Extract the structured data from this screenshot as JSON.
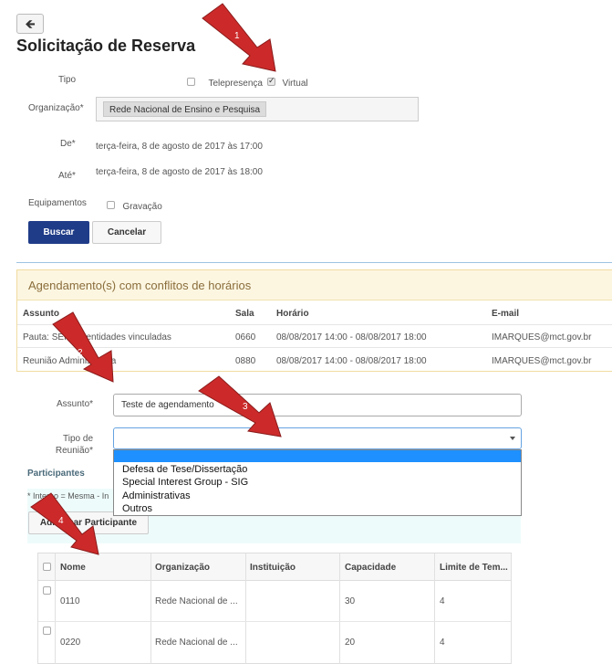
{
  "page": {
    "title": "Solicitação de Reserva"
  },
  "form": {
    "tipo_label": "Tipo",
    "tipo_options": [
      {
        "label": "Telepresença",
        "checked": false
      },
      {
        "label": "Virtual",
        "checked": true
      }
    ],
    "organizacao_label": "Organização*",
    "organizacao_value": "Rede Nacional de Ensino e Pesquisa",
    "de_label": "De*",
    "de_value": "terça-feira, 8 de agosto de 2017 às 17:00",
    "ate_label": "Até*",
    "ate_value": "terça-feira, 8 de agosto de 2017 às 18:00",
    "equipamentos_label": "Equipamentos",
    "gravacao_label": "Gravação",
    "buscar_label": "Buscar",
    "cancelar_label": "Cancelar"
  },
  "conflicts": {
    "title": "Agendamento(s) com conflitos de horários",
    "columns": [
      "Assunto",
      "Sala",
      "Horário",
      "E-mail"
    ],
    "rows": [
      {
        "assunto": "Pauta: SEI nas entidades vinculadas",
        "sala": "0660",
        "horario": "08/08/2017 14:00 - 08/08/2017 18:00",
        "email": "IMARQUES@mct.gov.br"
      },
      {
        "assunto": "Reunião Administrativa",
        "sala": "0880",
        "horario": "08/08/2017 14:00 - 08/08/2017 18:00",
        "email": "IMARQUES@mct.gov.br"
      }
    ]
  },
  "meeting": {
    "assunto_label": "Assunto*",
    "assunto_value": "Teste de agendamento",
    "tipo_label_line1": "Tipo de",
    "tipo_label_line2": "Reunião*",
    "tipo_options": [
      "Defesa de Tese/Dissertação",
      "Special Interest Group - SIG",
      "Administrativas",
      "Outros"
    ]
  },
  "participants": {
    "title": "Participantes",
    "note": "* Interno = Mesma - In",
    "add_label": "Adicionar Participante",
    "columns": [
      "Nome",
      "Organização",
      "Instituição",
      "Capacidade",
      "Limite de Tem..."
    ],
    "rows": [
      {
        "nome": "0110",
        "organizacao": "Rede Nacional de ...",
        "instituicao": "",
        "capacidade": "30",
        "limite": "4"
      },
      {
        "nome": "0220",
        "organizacao": "Rede Nacional de ...",
        "instituicao": "",
        "capacidade": "20",
        "limite": "4"
      }
    ]
  },
  "annotations": [
    "1",
    "2",
    "3",
    "4"
  ],
  "colors": {
    "primary_button": "#1f3c88",
    "annotation_arrow": "#cc2a2a",
    "dropdown_highlight": "#1e90ff",
    "warning_panel": "#fcf6e1"
  }
}
